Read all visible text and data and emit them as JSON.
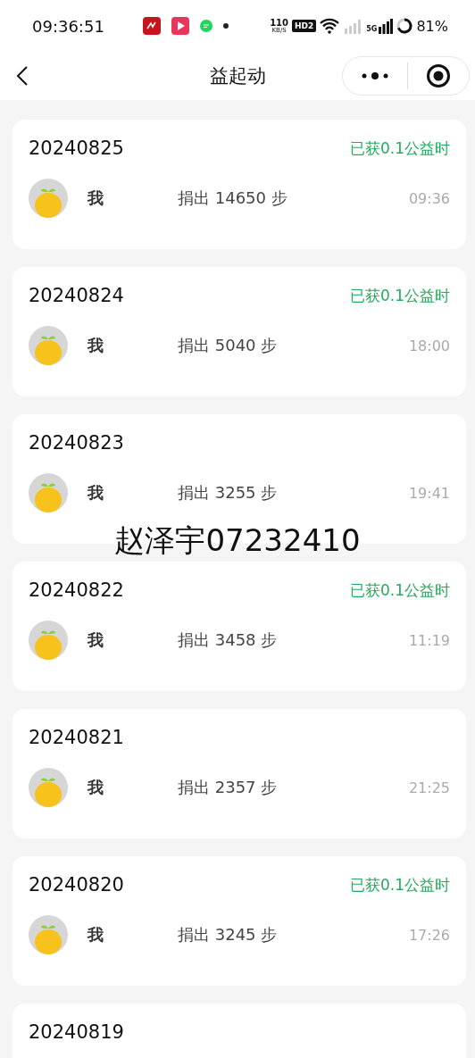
{
  "status_bar": {
    "time": "09:36:51",
    "net_speed": "110",
    "net_unit": "KB/S",
    "hd": "HD2",
    "network": "5G",
    "battery": "81%"
  },
  "nav": {
    "title": "益起动"
  },
  "records": [
    {
      "date": "20240825",
      "reward": "已获0.1公益时",
      "name": "我",
      "steps": "捐出 14650 步",
      "time": "09:36"
    },
    {
      "date": "20240824",
      "reward": "已获0.1公益时",
      "name": "我",
      "steps": "捐出 5040 步",
      "time": "18:00"
    },
    {
      "date": "20240823",
      "name": "我",
      "steps": "捐出 3255 步",
      "time": "19:41"
    },
    {
      "date": "20240822",
      "reward": "已获0.1公益时",
      "name": "我",
      "steps": "捐出 3458 步",
      "time": "11:19"
    },
    {
      "date": "20240821",
      "name": "我",
      "steps": "捐出 2357 步",
      "time": "21:25"
    },
    {
      "date": "20240820",
      "reward": "已获0.1公益时",
      "name": "我",
      "steps": "捐出 3245 步",
      "time": "17:26"
    },
    {
      "date": "20240819"
    }
  ],
  "overlay_text": "赵泽宇07232410"
}
